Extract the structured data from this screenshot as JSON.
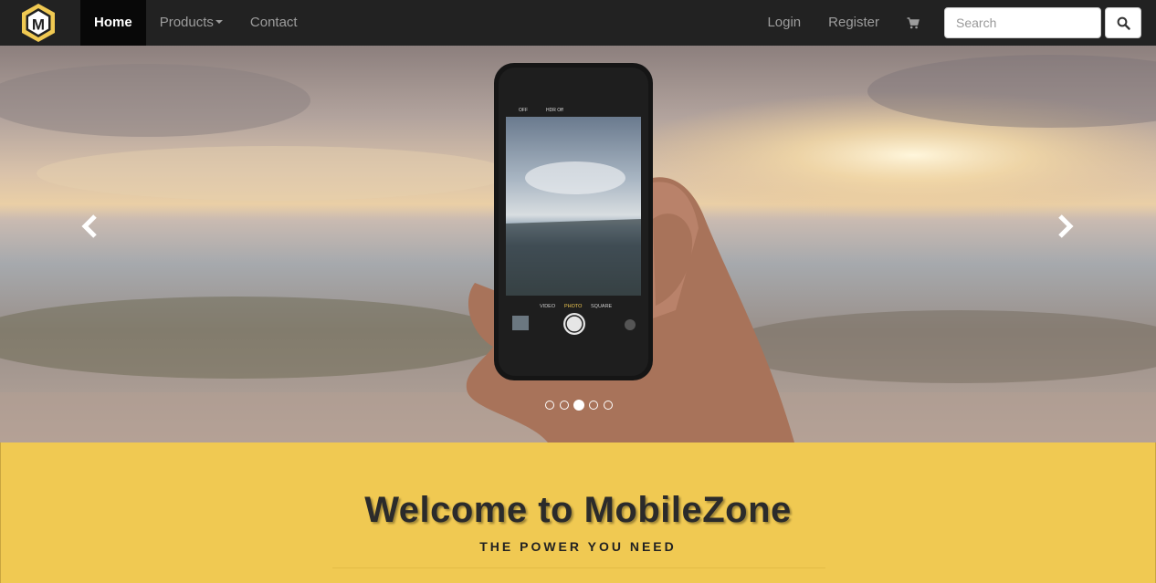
{
  "brand": {
    "logo_letter": "M",
    "logo_color": "#f0c952"
  },
  "nav": {
    "home_label": "Home",
    "products_label": "Products",
    "contact_label": "Contact",
    "login_label": "Login",
    "register_label": "Register",
    "cart_icon": "shopping-cart-icon"
  },
  "search": {
    "placeholder": "Search",
    "value": "",
    "button_icon": "search-icon"
  },
  "carousel": {
    "slide_count": 5,
    "active_index": 2,
    "prev_icon": "chevron-left-icon",
    "next_icon": "chevron-right-icon",
    "camera_modes": [
      "VIDEO",
      "PHOTO",
      "SQUARE"
    ],
    "camera_top_labels": [
      "OFF",
      "HDR Off"
    ]
  },
  "welcome": {
    "title": "Welcome to MobileZone",
    "tagline": "THE POWER YOU NEED",
    "background_color": "#f0c952"
  },
  "colors": {
    "navbar": "#222222",
    "nav_active": "#080808",
    "accent": "#f0c952"
  }
}
